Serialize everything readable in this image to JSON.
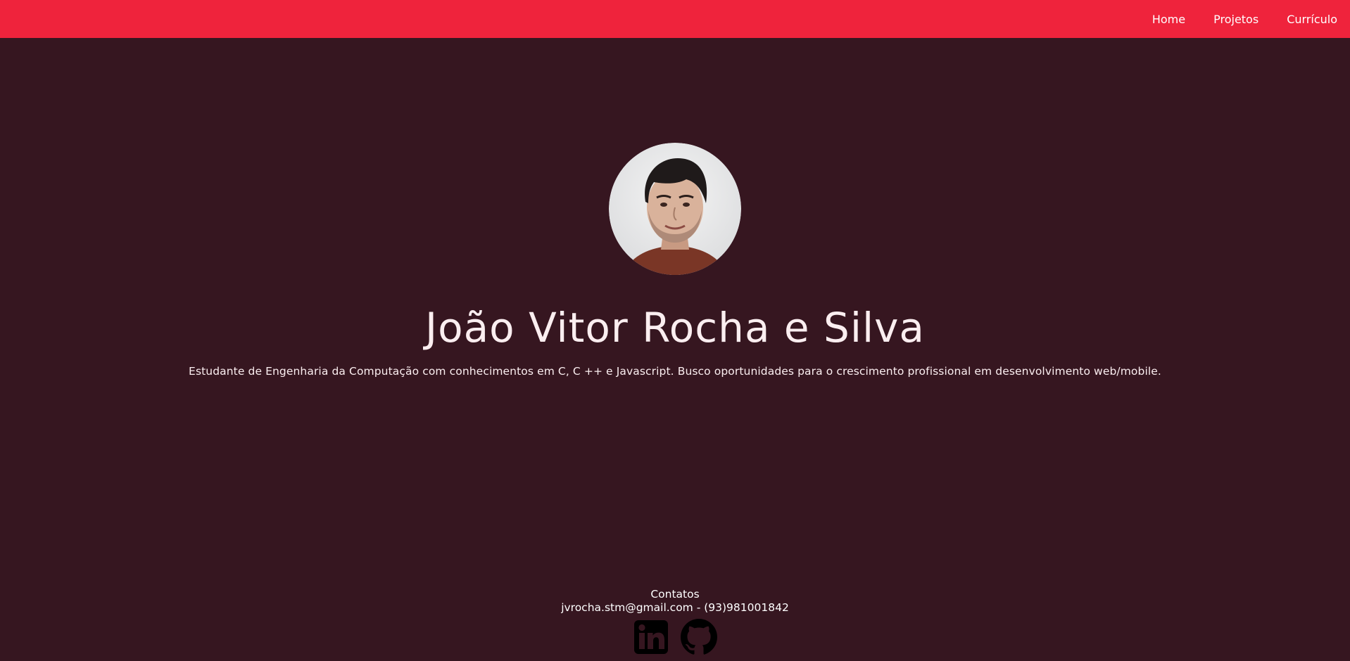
{
  "nav": {
    "items": [
      {
        "label": "Home"
      },
      {
        "label": "Projetos"
      },
      {
        "label": "Currículo"
      }
    ]
  },
  "profile": {
    "name": "João Vitor Rocha e Silva",
    "bio": "Estudante de Engenharia da Computação com conhecimentos em C, C ++ e Javascript. Busco oportunidades para o crescimento profissional em desenvolvimento web/mobile."
  },
  "contacts": {
    "heading": "Contatos",
    "line": "jvrocha.stm@gmail.com - (93)981001842"
  },
  "social": {
    "icons": [
      "linkedin-icon",
      "github-icon"
    ]
  },
  "colors": {
    "navbar": "#ef233c",
    "background": "#361620",
    "text": "#fbeef0"
  }
}
